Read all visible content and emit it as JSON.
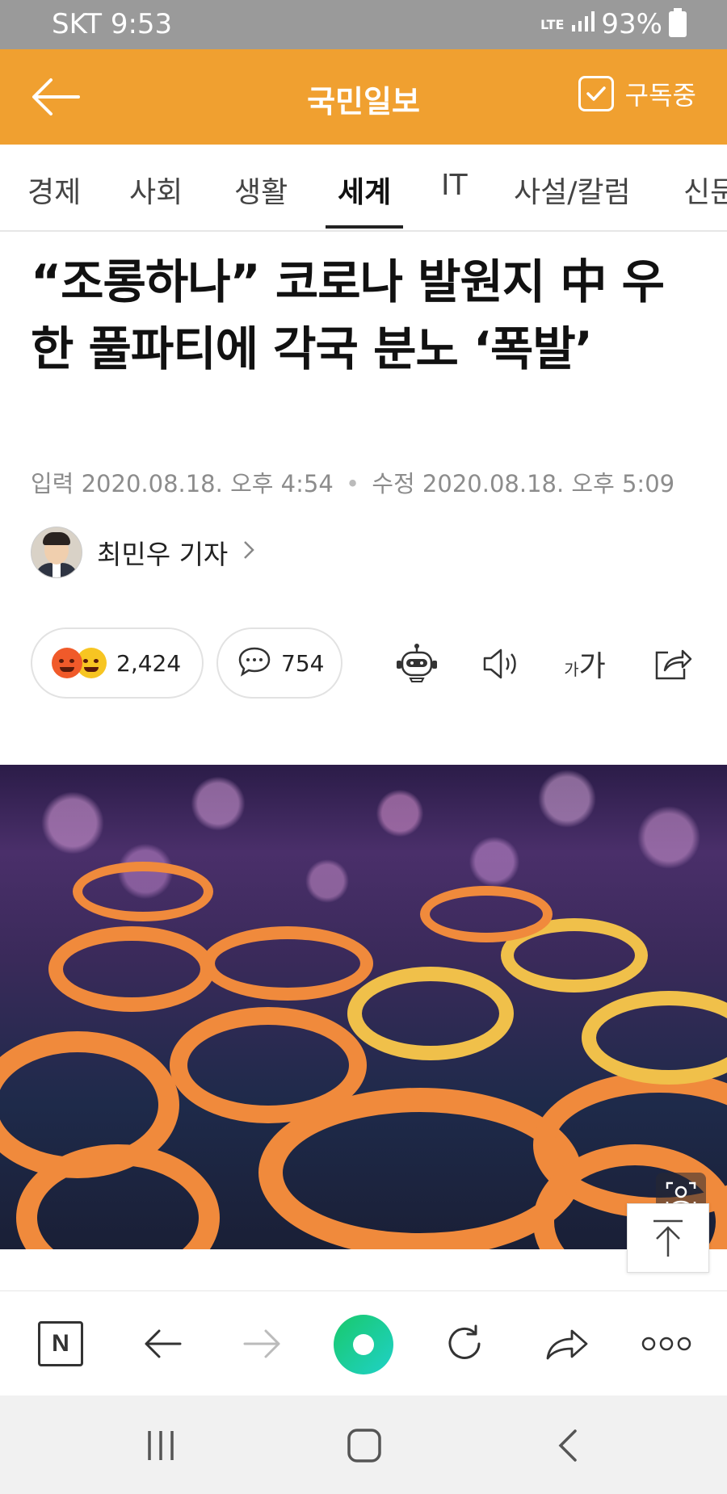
{
  "status_bar": {
    "carrier_time": "SKT 9:53",
    "network": "LTE",
    "battery": "93%"
  },
  "app_bar": {
    "title": "국민일보",
    "subscribe_label": "구독중"
  },
  "tabs": [
    {
      "label": "경제"
    },
    {
      "label": "사회"
    },
    {
      "label": "생활"
    },
    {
      "label": "세계",
      "active": true
    },
    {
      "label": "IT"
    },
    {
      "label": "사설/칼럼"
    },
    {
      "label": "신문"
    }
  ],
  "article": {
    "headline": "“조롱하나” 코로나 발원지 中 우한 풀파티에 각국 분노 ‘폭발’",
    "input_label": "입력",
    "input_time": "2020.08.18. 오후 4:54",
    "edit_label": "수정",
    "edit_time": "2020.08.18. 오후 5:09",
    "author": "최민우 기자",
    "reaction_count": "2,424",
    "comment_count": "754",
    "font_size_label_small": "가",
    "font_size_label_large": "가"
  },
  "browser_bar": {
    "n_label": "N"
  }
}
